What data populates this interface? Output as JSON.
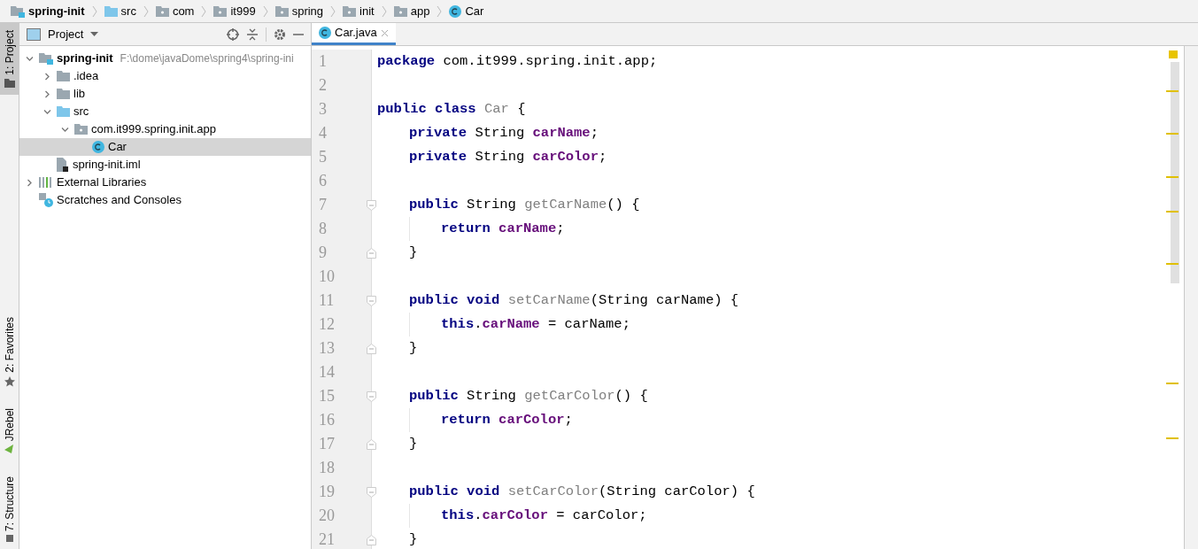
{
  "breadcrumbs": [
    {
      "kind": "module",
      "label": "spring-init"
    },
    {
      "kind": "source",
      "label": "src"
    },
    {
      "kind": "package",
      "label": "com"
    },
    {
      "kind": "package",
      "label": "it999"
    },
    {
      "kind": "package",
      "label": "spring"
    },
    {
      "kind": "package",
      "label": "init"
    },
    {
      "kind": "package",
      "label": "app"
    },
    {
      "kind": "class",
      "label": "Car"
    }
  ],
  "left_strip_top": [
    {
      "label": "1: Project",
      "kind": "folder",
      "selected": true
    }
  ],
  "left_strip_bottom": [
    {
      "label": "2: Favorites",
      "kind": "star",
      "selected": false
    },
    {
      "label": "JRebel",
      "kind": "jrebel",
      "selected": false
    },
    {
      "label": "7: Structure",
      "kind": "structure",
      "selected": false
    }
  ],
  "project_panel": {
    "title": "Project",
    "tree": [
      {
        "kind": "module",
        "label": "spring-init",
        "path": "F:\\dome\\javaDome\\spring4\\spring-ini",
        "expanded": true,
        "selected": false,
        "children": [
          {
            "kind": "folder",
            "label": ".idea",
            "expanded": false,
            "selected": false
          },
          {
            "kind": "folder",
            "label": "lib",
            "expanded": false,
            "selected": false
          },
          {
            "kind": "source",
            "label": "src",
            "expanded": true,
            "selected": false,
            "children": [
              {
                "kind": "package",
                "label": "com.it999.spring.init.app",
                "expanded": true,
                "selected": false,
                "children": [
                  {
                    "kind": "class",
                    "label": "Car",
                    "selected": true
                  }
                ]
              }
            ]
          },
          {
            "kind": "iml",
            "label": "spring-init.iml",
            "selected": false
          }
        ]
      },
      {
        "kind": "libraries",
        "label": "External Libraries",
        "expanded": false,
        "selected": false
      },
      {
        "kind": "scratches",
        "label": "Scratches and Consoles",
        "selected": false
      }
    ]
  },
  "editor": {
    "tabs": [
      {
        "label": "Car.java",
        "selected": true
      }
    ],
    "lines": [
      {
        "number": "1",
        "tokens": [
          {
            "kind": "keyword",
            "text": "package"
          },
          {
            "kind": "plain",
            "text": " com.it999.spring.init.app;"
          }
        ]
      },
      {
        "number": "2"
      },
      {
        "number": "3",
        "tokens": [
          {
            "kind": "keyword",
            "text": "public class"
          },
          {
            "kind": "declaration",
            "text": " Car"
          },
          {
            "kind": "plain",
            "text": " {"
          }
        ],
        "children": [
          {
            "number": "4",
            "tokens": [
              {
                "kind": "keyword",
                "text": "private"
              },
              {
                "kind": "plain",
                "text": " String "
              },
              {
                "kind": "field",
                "text": "carName"
              },
              {
                "kind": "plain",
                "text": ";"
              }
            ]
          },
          {
            "number": "5",
            "tokens": [
              {
                "kind": "keyword",
                "text": "private"
              },
              {
                "kind": "plain",
                "text": " String "
              },
              {
                "kind": "field",
                "text": "carColor"
              },
              {
                "kind": "plain",
                "text": ";"
              }
            ]
          },
          {
            "number": "6"
          },
          {
            "number": "7",
            "fold_start": true,
            "tokens": [
              {
                "kind": "keyword",
                "text": "public"
              },
              {
                "kind": "plain",
                "text": " String "
              },
              {
                "kind": "declaration",
                "text": "getCarName"
              },
              {
                "kind": "plain",
                "text": "() {"
              }
            ],
            "children": [
              {
                "number": "8",
                "tokens": [
                  {
                    "kind": "keyword",
                    "text": "return"
                  },
                  {
                    "kind": "field",
                    "text": " carName"
                  },
                  {
                    "kind": "plain",
                    "text": ";"
                  }
                ]
              }
            ]
          },
          {
            "number": "9",
            "fold_end": true,
            "tokens": [
              {
                "kind": "plain",
                "text": "}"
              }
            ]
          },
          {
            "number": "10"
          },
          {
            "number": "11",
            "fold_start": true,
            "tokens": [
              {
                "kind": "keyword",
                "text": "public void"
              },
              {
                "kind": "declaration",
                "text": " setCarName"
              },
              {
                "kind": "plain",
                "text": "(String carName) {"
              }
            ],
            "children": [
              {
                "number": "12",
                "tokens": [
                  {
                    "kind": "keyword",
                    "text": "this"
                  },
                  {
                    "kind": "plain",
                    "text": "."
                  },
                  {
                    "kind": "field",
                    "text": "carName"
                  },
                  {
                    "kind": "plain",
                    "text": " = carName;"
                  }
                ]
              }
            ]
          },
          {
            "number": "13",
            "fold_end": true,
            "tokens": [
              {
                "kind": "plain",
                "text": "}"
              }
            ]
          },
          {
            "number": "14"
          },
          {
            "number": "15",
            "fold_start": true,
            "tokens": [
              {
                "kind": "keyword",
                "text": "public"
              },
              {
                "kind": "plain",
                "text": " String "
              },
              {
                "kind": "declaration",
                "text": "getCarColor"
              },
              {
                "kind": "plain",
                "text": "() {"
              }
            ],
            "children": [
              {
                "number": "16",
                "tokens": [
                  {
                    "kind": "keyword",
                    "text": "return"
                  },
                  {
                    "kind": "field",
                    "text": " carColor"
                  },
                  {
                    "kind": "plain",
                    "text": ";"
                  }
                ]
              }
            ]
          },
          {
            "number": "17",
            "fold_end": true,
            "tokens": [
              {
                "kind": "plain",
                "text": "}"
              }
            ]
          },
          {
            "number": "18"
          },
          {
            "number": "19",
            "fold_start": true,
            "tokens": [
              {
                "kind": "keyword",
                "text": "public void"
              },
              {
                "kind": "declaration",
                "text": " setCarColor"
              },
              {
                "kind": "plain",
                "text": "(String carColor) {"
              }
            ],
            "children": [
              {
                "number": "20",
                "tokens": [
                  {
                    "kind": "keyword",
                    "text": "this"
                  },
                  {
                    "kind": "plain",
                    "text": "."
                  },
                  {
                    "kind": "field",
                    "text": "carColor"
                  },
                  {
                    "kind": "plain",
                    "text": " = carColor;"
                  }
                ]
              }
            ]
          },
          {
            "number": "21",
            "fold_end": true,
            "tokens": [
              {
                "kind": "plain",
                "text": "}"
              }
            ]
          }
        ]
      }
    ]
  }
}
